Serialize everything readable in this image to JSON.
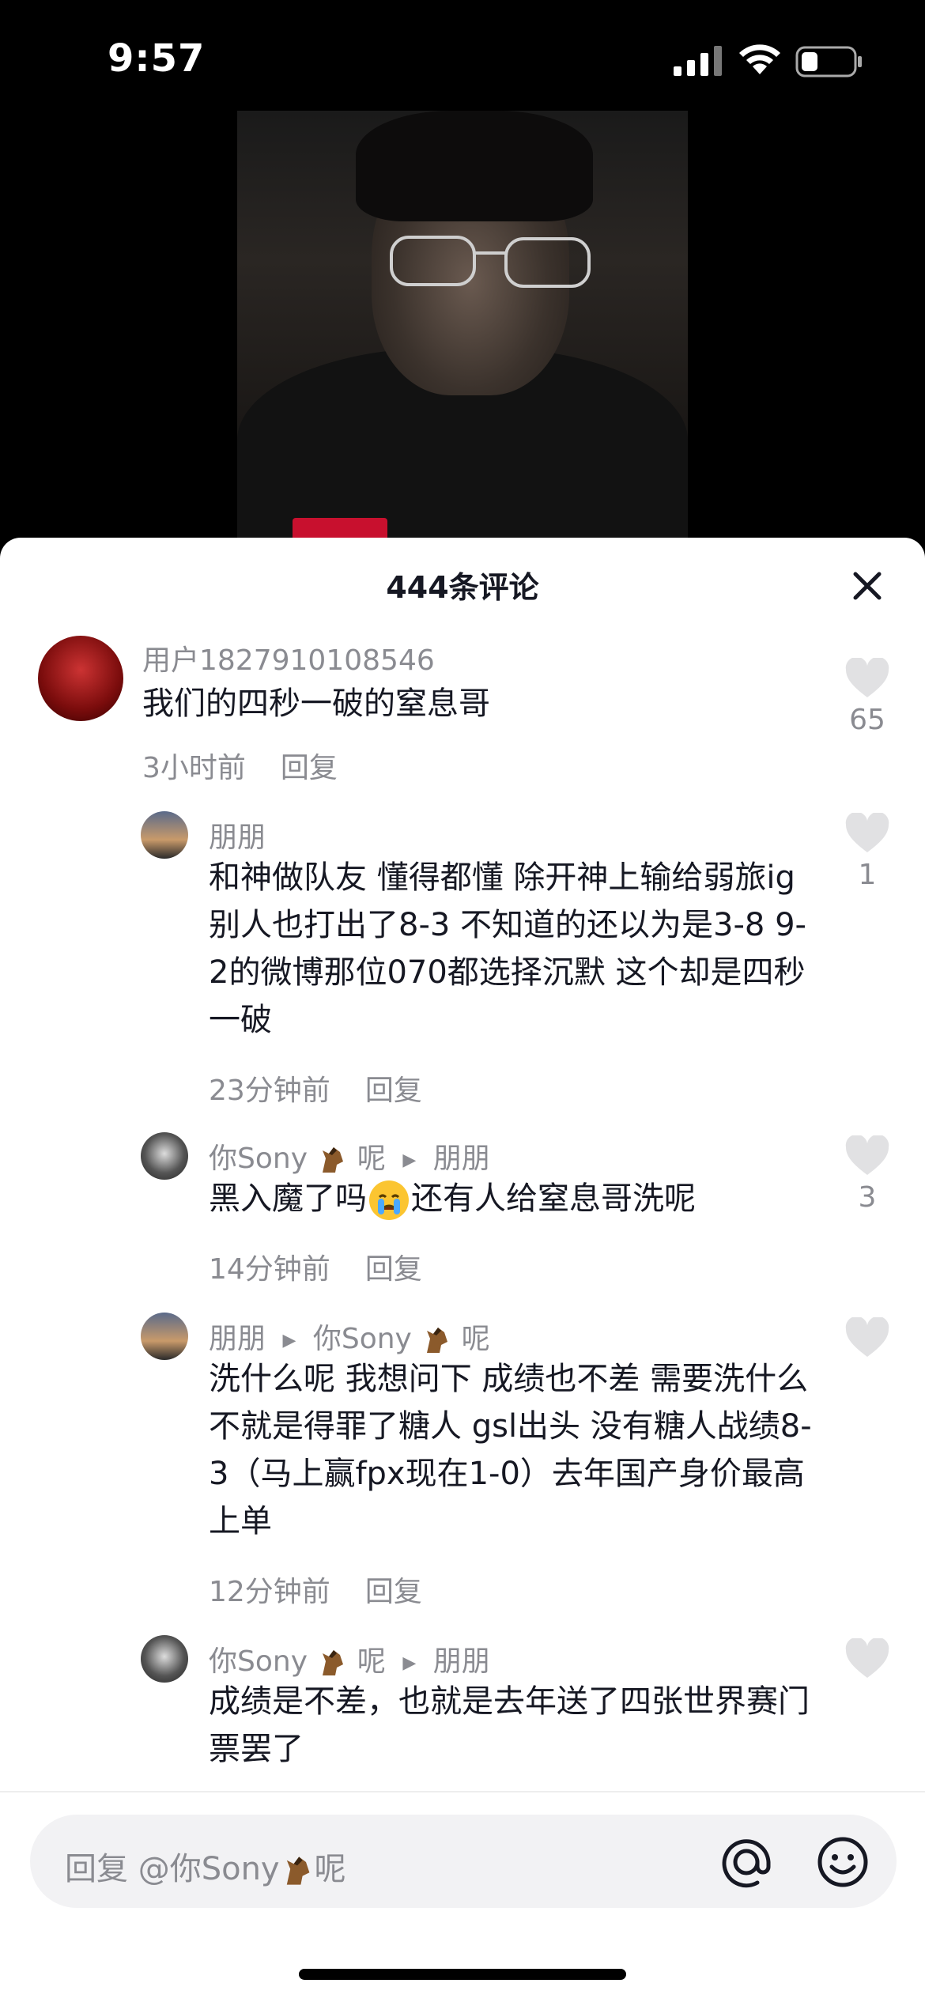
{
  "status_bar": {
    "time": "9:57"
  },
  "sheet": {
    "title": "444条评论"
  },
  "comments": [
    {
      "user": "用户1827910108546",
      "text": "我们的四秒一破的窒息哥",
      "time": "3小时前",
      "reply": "回复",
      "likes": "65"
    },
    {
      "user": "朋朋",
      "text": "和神做队友 懂得都懂 除开神上输给弱旅ig 别人也打出了8-3 不知道的还以为是3-8 9-2的微博那位070都选择沉默 这个却是四秒一破",
      "time": "23分钟前",
      "reply": "回复",
      "likes": "1"
    },
    {
      "user": "你Sony",
      "user_suffix": "呢",
      "reply_to": "朋朋",
      "text_a": "黑入魔了吗",
      "text_b": "还有人给窒息哥洗呢",
      "time": "14分钟前",
      "reply": "回复",
      "likes": "3"
    },
    {
      "user": "朋朋",
      "reply_to": "你Sony",
      "reply_to_suffix": "呢",
      "text": "洗什么呢 我想问下 成绩也不差 需要洗什么 不就是得罪了糖人 gsl出头 没有糖人战绩8-3（马上赢fpx现在1-0）去年国产身价最高上单",
      "time": "12分钟前",
      "reply": "回复",
      "likes": ""
    },
    {
      "user": "你Sony",
      "user_suffix": "呢",
      "reply_to": "朋朋",
      "text": "成绩是不差，也就是去年送了四张世界赛门票罢了",
      "time": "",
      "reply": "",
      "likes": ""
    }
  ],
  "input": {
    "placeholder_prefix": "回复 @你Sony",
    "placeholder_suffix": "呢"
  },
  "icons": {
    "close": "close-icon",
    "like": "heart-icon",
    "at": "at-icon",
    "emoji": "emoji-icon",
    "horse_emoji": "horse-emoji",
    "crying_emoji": "crying-emoji"
  },
  "colors": {
    "text": "#161823",
    "muted": "#8a8b91",
    "like_gray": "#e1e1e3"
  }
}
